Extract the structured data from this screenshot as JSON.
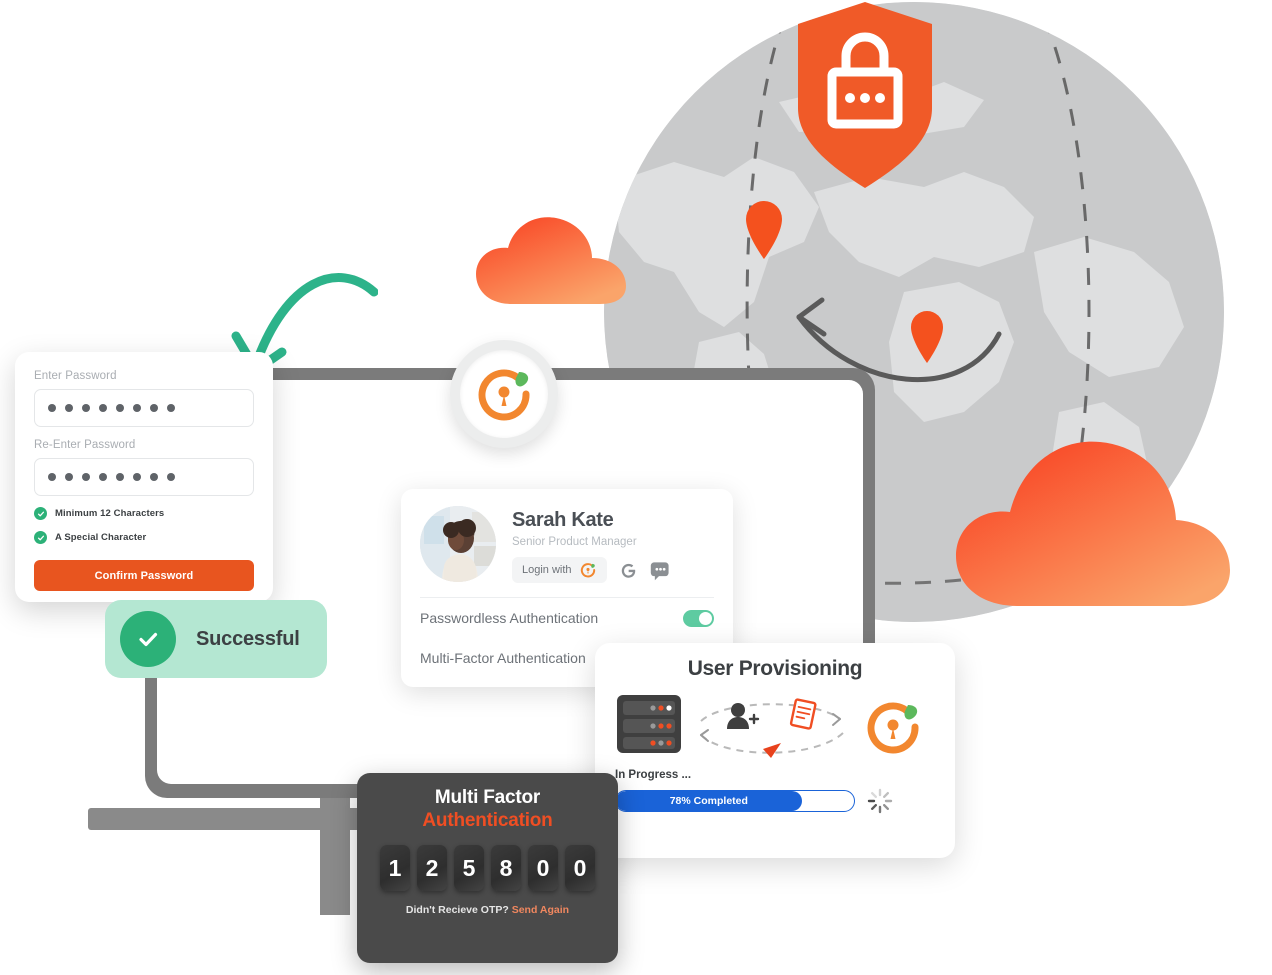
{
  "password_card": {
    "name": "password-setup-card",
    "enter_label": "Enter Password",
    "reenter_label": "Re-Enter Password",
    "password_value": "••••••••",
    "reenter_value": "••••••••",
    "dots_count": 8,
    "requirements": [
      {
        "label": "Minimum 12 Characters",
        "met": true
      },
      {
        "label": "A Special Character",
        "met": true
      }
    ],
    "confirm_label": "Confirm Password",
    "confirm_color": "#E8551F"
  },
  "toast": {
    "label": "Successful",
    "bg_color": "#B4E7D2",
    "circle_color": "#2CB178",
    "icon": "check-icon"
  },
  "profile_card": {
    "name": "Sarah Kate",
    "role": "Senior Product Manager",
    "login_with_label": "Login with",
    "providers": [
      "cyberark-icon",
      "google-icon",
      "discord-icon"
    ],
    "auth_options": [
      {
        "label": "Passwordless Authentication",
        "enabled": true
      },
      {
        "label": "Multi-Factor Authentication",
        "enabled": true
      }
    ],
    "toggle_on_color": "#5ECBA1"
  },
  "provisioning_card": {
    "title": "User Provisioning",
    "status": "In Progress ...",
    "progress_label": "78% Completed",
    "progress_percent": 78,
    "bar_color": "#1A63D8",
    "icons": [
      "server-rack-icon",
      "user-add-icon",
      "document-icon",
      "identity-ring-icon",
      "spinner-icon"
    ]
  },
  "mfa_card": {
    "title_line1": "Multi Factor",
    "title_line2": "Authentication",
    "title_accent_color": "#F04E23",
    "otp_digits": [
      "1",
      "2",
      "5",
      "8",
      "0",
      "0"
    ],
    "footer_prompt": "Didn't Recieve OTP?",
    "footer_action": "Send Again",
    "footer_action_color": "#F0875F",
    "bg_color": "#4A4A4A"
  },
  "graphics": {
    "shield": {
      "name": "security-shield-icon",
      "color": "#F05A28",
      "lock_dots": 3
    },
    "globe": {
      "name": "world-globe",
      "color": "#C9CACB",
      "pin_color": "#F4511E",
      "pins": 2
    },
    "cloud_small": {
      "name": "cloud-icon",
      "from": "#F93E1F",
      "to": "#FAA46A"
    },
    "cloud_large": {
      "name": "cloud-icon",
      "from": "#F93E1F",
      "to": "#FAA46A"
    },
    "arrow": {
      "name": "curved-arrow-icon",
      "color": "#2DB38A"
    },
    "logo_badge": {
      "name": "identity-logo-badge",
      "ring_color": "#F2872F",
      "leaf_color": "#5CB85C"
    },
    "monitor": {
      "name": "desktop-monitor",
      "bezel_color": "#7B7B7B"
    }
  }
}
